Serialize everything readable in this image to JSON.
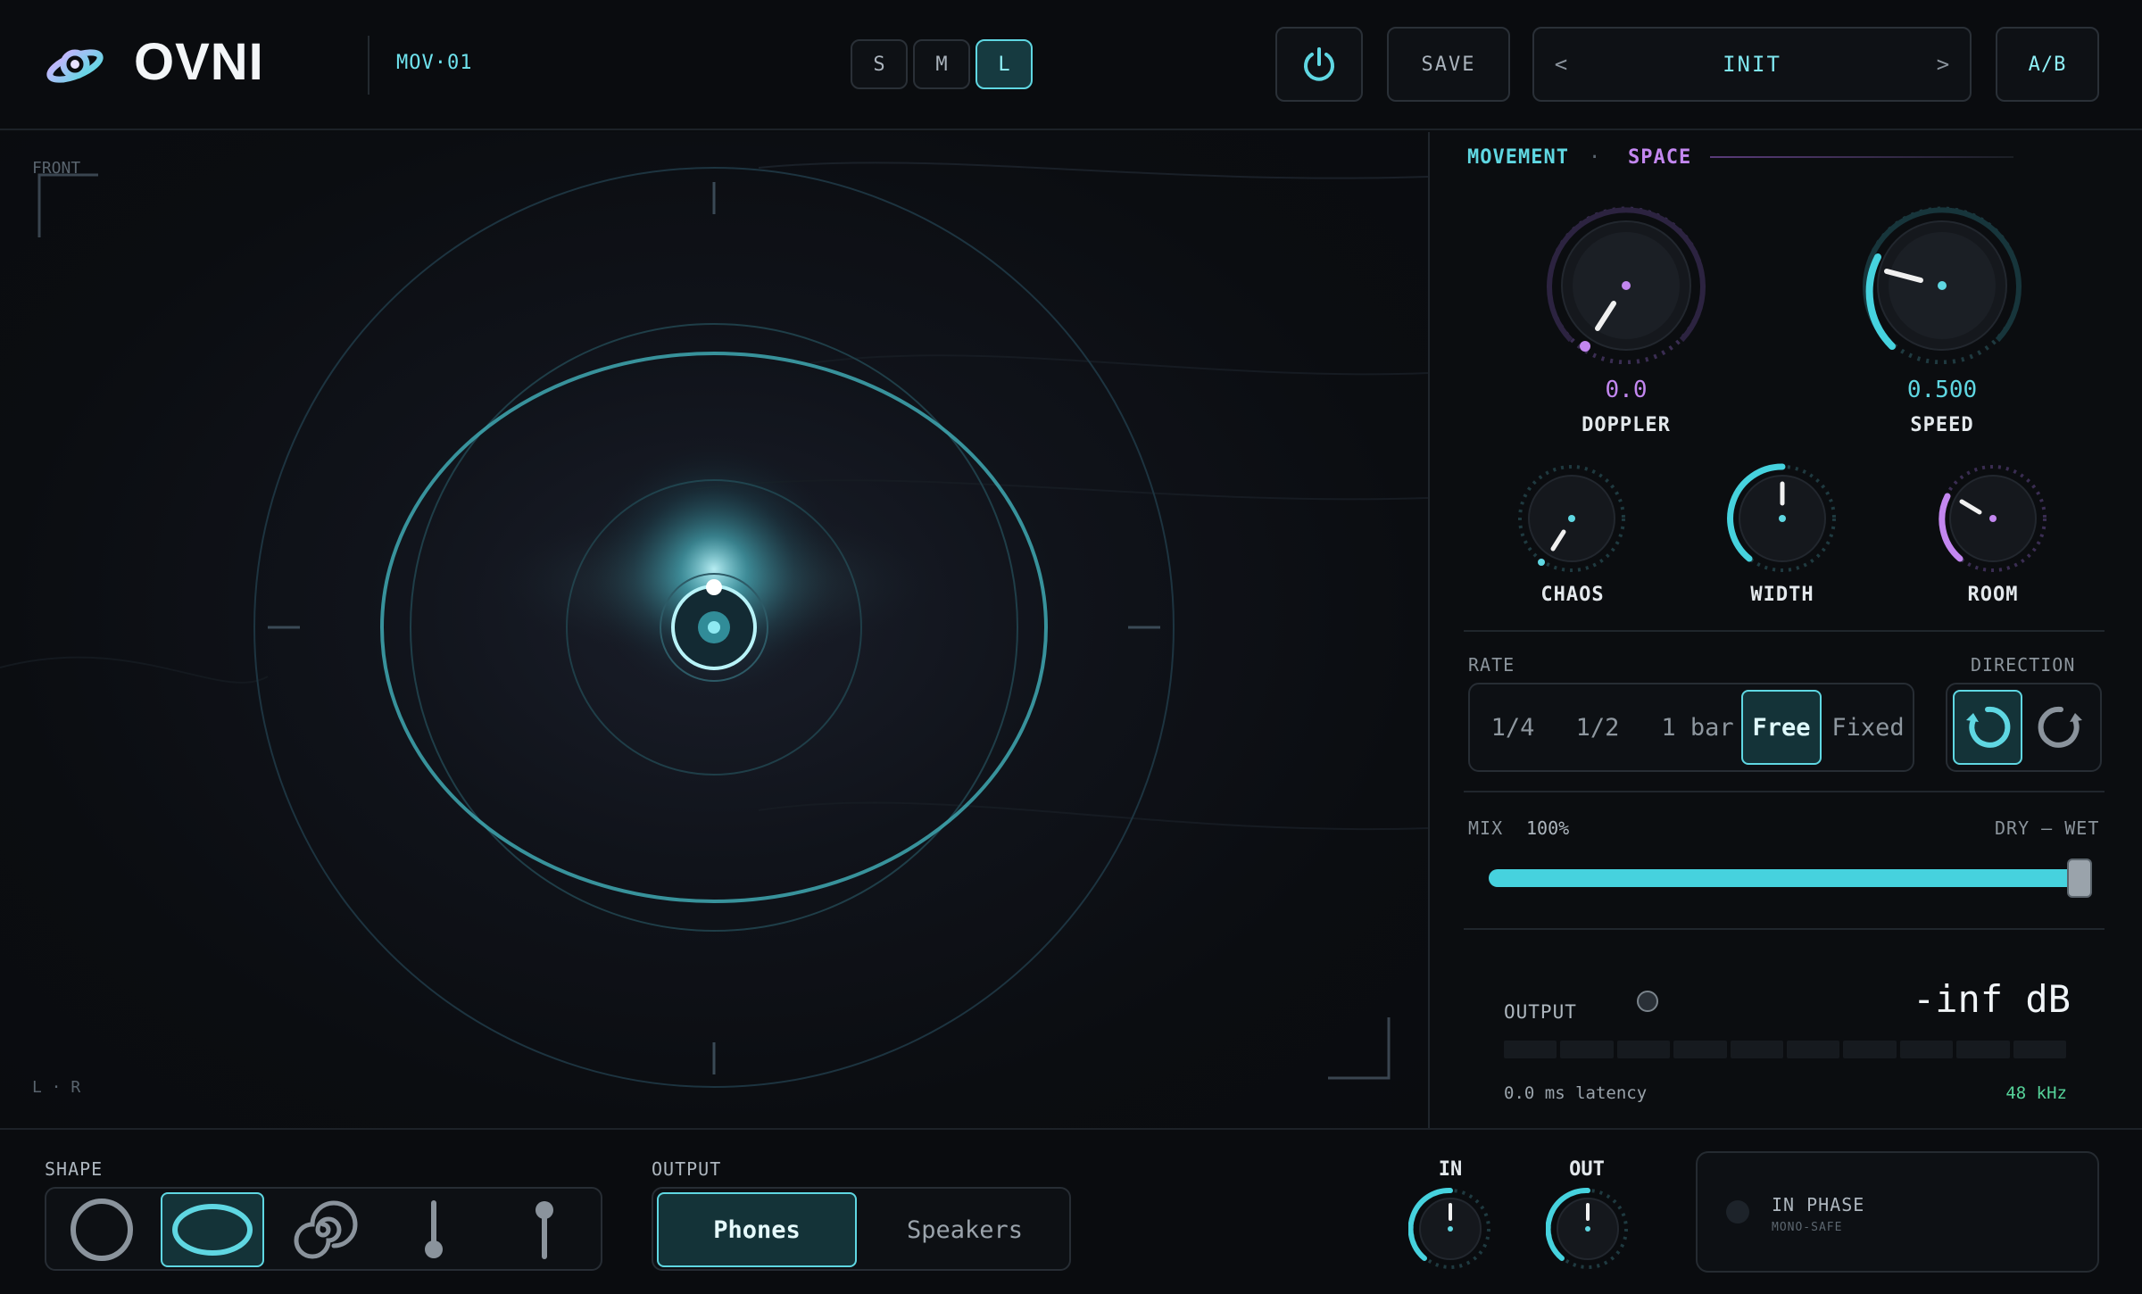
{
  "header": {
    "brand": "OVNI",
    "preset_code": "MOV·01",
    "size_buttons": [
      "S",
      "M",
      "L"
    ],
    "size_active": "L",
    "save_label": "SAVE",
    "prev_label": "<",
    "preset_name": "INIT",
    "next_label": ">",
    "ab_label": "A/B"
  },
  "visualizer": {
    "front_label": "FRONT",
    "lr_label": "L · R"
  },
  "panel": {
    "tabs": {
      "movement": "MOVEMENT",
      "separator": "·",
      "space": "SPACE"
    },
    "knobs": {
      "doppler": {
        "label": "DOPPLER",
        "value": "0.0"
      },
      "speed": {
        "label": "SPEED",
        "value": "0.500"
      },
      "chaos": {
        "label": "CHAOS"
      },
      "width": {
        "label": "WIDTH"
      },
      "room": {
        "label": "ROOM"
      }
    },
    "rate": {
      "label": "RATE",
      "options": [
        "1/4",
        "1/2",
        "1 bar",
        "Free",
        "Fixed"
      ],
      "selected": "Free"
    },
    "direction": {
      "label": "DIRECTION",
      "selected": "counter-clockwise"
    },
    "mix": {
      "label": "MIX",
      "value": "100%",
      "percent": 100,
      "range_label": "DRY — WET"
    },
    "output": {
      "label": "OUTPUT",
      "level": "-inf dB",
      "latency": "0.0 ms latency",
      "sample_rate": "48 kHz"
    }
  },
  "footer": {
    "shape": {
      "label": "SHAPE",
      "options": [
        "circle-icon",
        "ellipse-icon",
        "spiral-icon",
        "line-down-icon",
        "line-up-icon"
      ],
      "selected": "ellipse-icon"
    },
    "output_mode": {
      "label": "OUTPUT",
      "options": [
        "Phones",
        "Speakers"
      ],
      "selected": "Phones"
    },
    "in_label": "IN",
    "out_label": "OUT",
    "phase": {
      "title": "IN PHASE",
      "subtitle": "MONO-SAFE"
    }
  },
  "colors": {
    "accent_cyan": "#5fd7e2",
    "accent_purple": "#c387f0",
    "background": "#0b0d10",
    "sample_rate_green": "#56d39a"
  }
}
